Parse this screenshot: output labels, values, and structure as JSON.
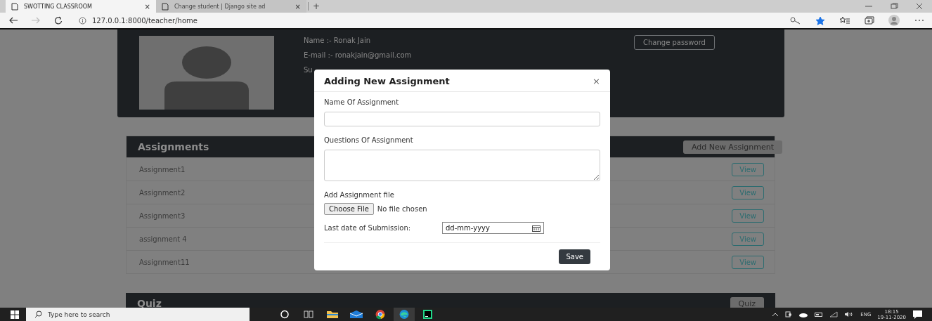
{
  "browser": {
    "tabs": [
      {
        "title": "SWOTTING CLASSROOM",
        "close": "×",
        "selected": true
      },
      {
        "title": "Change student | Django site ad",
        "close": "×",
        "selected": false
      }
    ],
    "new_tab": "+",
    "url": "127.0.0.1:8000/teacher/home",
    "bookmarked": true
  },
  "profile": {
    "name": "Name :- Ronak Jain",
    "email": "E-mail :- ronakjain@gmail.com",
    "subject": "Su",
    "change_password": "Change password"
  },
  "assignments": {
    "title": "Assignments",
    "add_button": "Add New Assignment",
    "rows": [
      {
        "name": "Assignment1",
        "action": "View"
      },
      {
        "name": "Assignment2",
        "action": "View"
      },
      {
        "name": "Assignment3",
        "action": "View"
      },
      {
        "name": "assignment 4",
        "action": "View"
      },
      {
        "name": "Assignment11",
        "action": "View"
      }
    ]
  },
  "quiz": {
    "title": "Quiz",
    "button": "Quiz"
  },
  "modal": {
    "title": "Adding New Assignment",
    "close": "×",
    "name_label": "Name Of Assignment",
    "questions_label": "Questions Of Assignment",
    "file_label": "Add Assignment file",
    "file_button": "Choose File",
    "file_status": "No file chosen",
    "date_label": "Last date of Submission:",
    "date_placeholder": "dd-mm-yyyy",
    "save": "Save"
  },
  "taskbar": {
    "search_placeholder": "Type here to search",
    "language": "ENG",
    "time": "18:15",
    "date": "19-11-2020"
  }
}
